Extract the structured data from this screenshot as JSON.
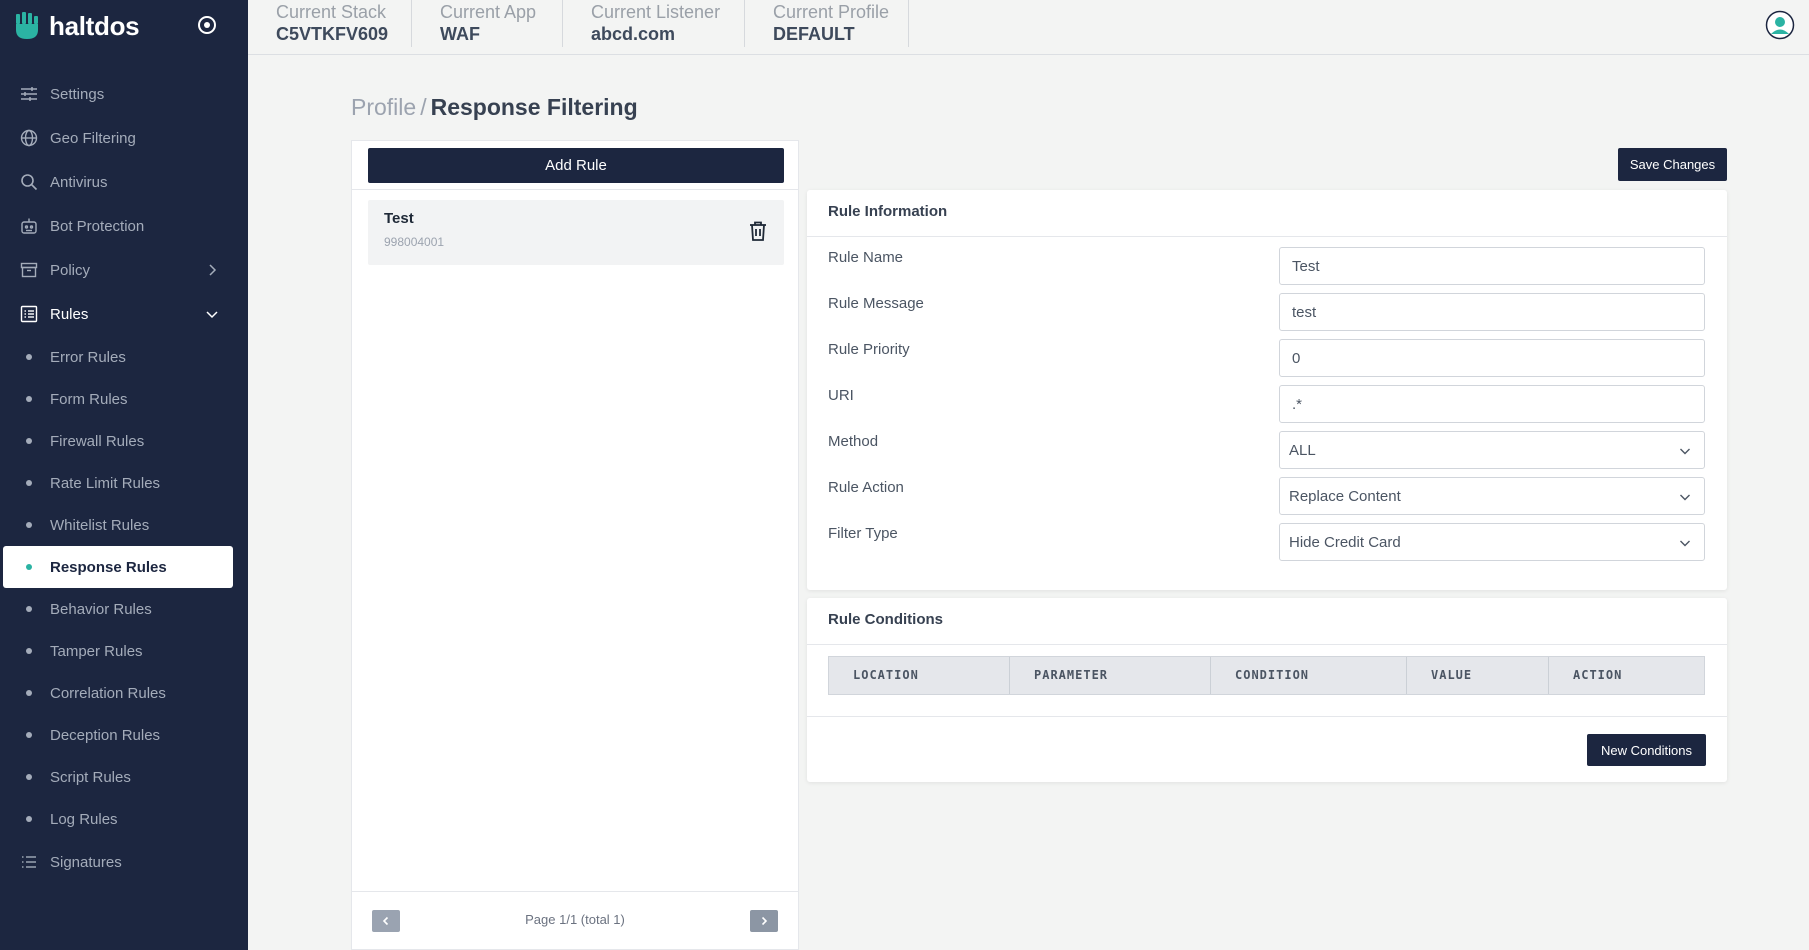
{
  "brand": {
    "name": "haltdos"
  },
  "colors": {
    "sidebar": "#1c2640",
    "accent": "#2bb3a3",
    "button": "#1c2640",
    "background": "#f3f4f3"
  },
  "sidebar": {
    "items": [
      {
        "label": "Settings",
        "icon": "sliders-icon"
      },
      {
        "label": "Geo Filtering",
        "icon": "globe-icon"
      },
      {
        "label": "Antivirus",
        "icon": "search-icon"
      },
      {
        "label": "Bot Protection",
        "icon": "robot-icon"
      },
      {
        "label": "Policy",
        "icon": "archive-icon"
      },
      {
        "label": "Rules",
        "icon": "list-icon"
      }
    ],
    "rules_sub": [
      "Error Rules",
      "Form Rules",
      "Firewall Rules",
      "Rate Limit Rules",
      "Whitelist Rules",
      "Response Rules",
      "Behavior Rules",
      "Tamper Rules",
      "Correlation Rules",
      "Deception Rules",
      "Script Rules",
      "Log Rules"
    ],
    "signatures": "Signatures",
    "active": "Response Rules"
  },
  "topbar": {
    "stack_label": "Current Stack",
    "stack_value": "C5VTKFV609",
    "app_label": "Current App",
    "app_value": "WAF",
    "listener_label": "Current Listener",
    "listener_value": "abcd.com",
    "profile_label": "Current Profile",
    "profile_value": "DEFAULT"
  },
  "breadcrumb": {
    "parent": "Profile",
    "separator": "/",
    "current": "Response Filtering"
  },
  "rule_list": {
    "add_label": "Add Rule",
    "rules": [
      {
        "name": "Test",
        "id": "998004001"
      }
    ],
    "pagination": "Page 1/1 (total 1)"
  },
  "save_label": "Save Changes",
  "rule_info": {
    "title": "Rule Information",
    "name_label": "Rule Name",
    "name_value": "Test",
    "message_label": "Rule Message",
    "message_value": "test",
    "priority_label": "Rule Priority",
    "priority_value": "0",
    "uri_label": "URI",
    "uri_value": ".*",
    "method_label": "Method",
    "method_value": "ALL",
    "action_label": "Rule Action",
    "action_value": "Replace Content",
    "filter_label": "Filter Type",
    "filter_value": "Hide Credit Card"
  },
  "conditions": {
    "title": "Rule Conditions",
    "columns": [
      "LOCATION",
      "PARAMETER",
      "CONDITION",
      "VALUE",
      "ACTION"
    ],
    "new_label": "New Conditions"
  }
}
